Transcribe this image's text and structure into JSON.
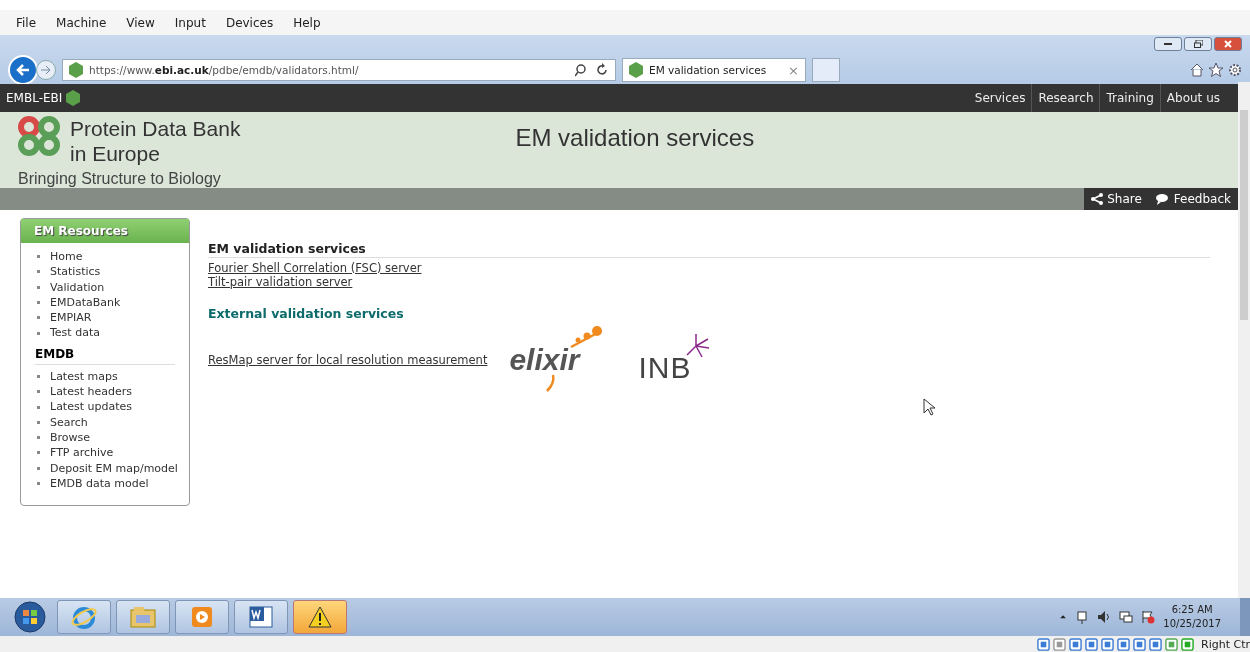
{
  "vm_menu": [
    "File",
    "Machine",
    "View",
    "Input",
    "Devices",
    "Help"
  ],
  "browser": {
    "url_prefix": "https://www.",
    "url_domain": "ebi.ac.uk",
    "url_path": "/pdbe/emdb/validators.html/",
    "tab_title": "EM validation services",
    "tab_close": "×"
  },
  "site_bar": {
    "brand": "EMBL-EBI",
    "nav": [
      "Services",
      "Research",
      "Training",
      "About us"
    ]
  },
  "header": {
    "title_line1": "Protein Data Bank",
    "title_line2": "in Europe",
    "tagline": "Bringing Structure to Biology",
    "page_title": "EM validation services"
  },
  "action_bar": [
    "Share",
    "Feedback"
  ],
  "sidebar": {
    "title": "EM Resources",
    "items": [
      "Home",
      "Statistics",
      "Validation",
      "EMDataBank",
      "EMPIAR",
      "Test data"
    ],
    "section": "EMDB",
    "section_items": [
      "Latest maps",
      "Latest headers",
      "Latest updates",
      "Search",
      "Browse",
      "FTP archive",
      "Deposit EM map/model",
      "EMDB data model"
    ]
  },
  "content": {
    "heading": "EM validation services",
    "links": [
      "Fourier Shell Correlation (FSC) server",
      "Tilt-pair validation server"
    ],
    "external_heading": "External validation services",
    "external_link": "ResMap server for local resolution measurement",
    "logos": [
      "elixir",
      "INB"
    ]
  },
  "taskbar": {
    "time": "6:25 AM",
    "date": "10/25/2017"
  },
  "vm_status": {
    "host_key": "Right Ctr"
  }
}
